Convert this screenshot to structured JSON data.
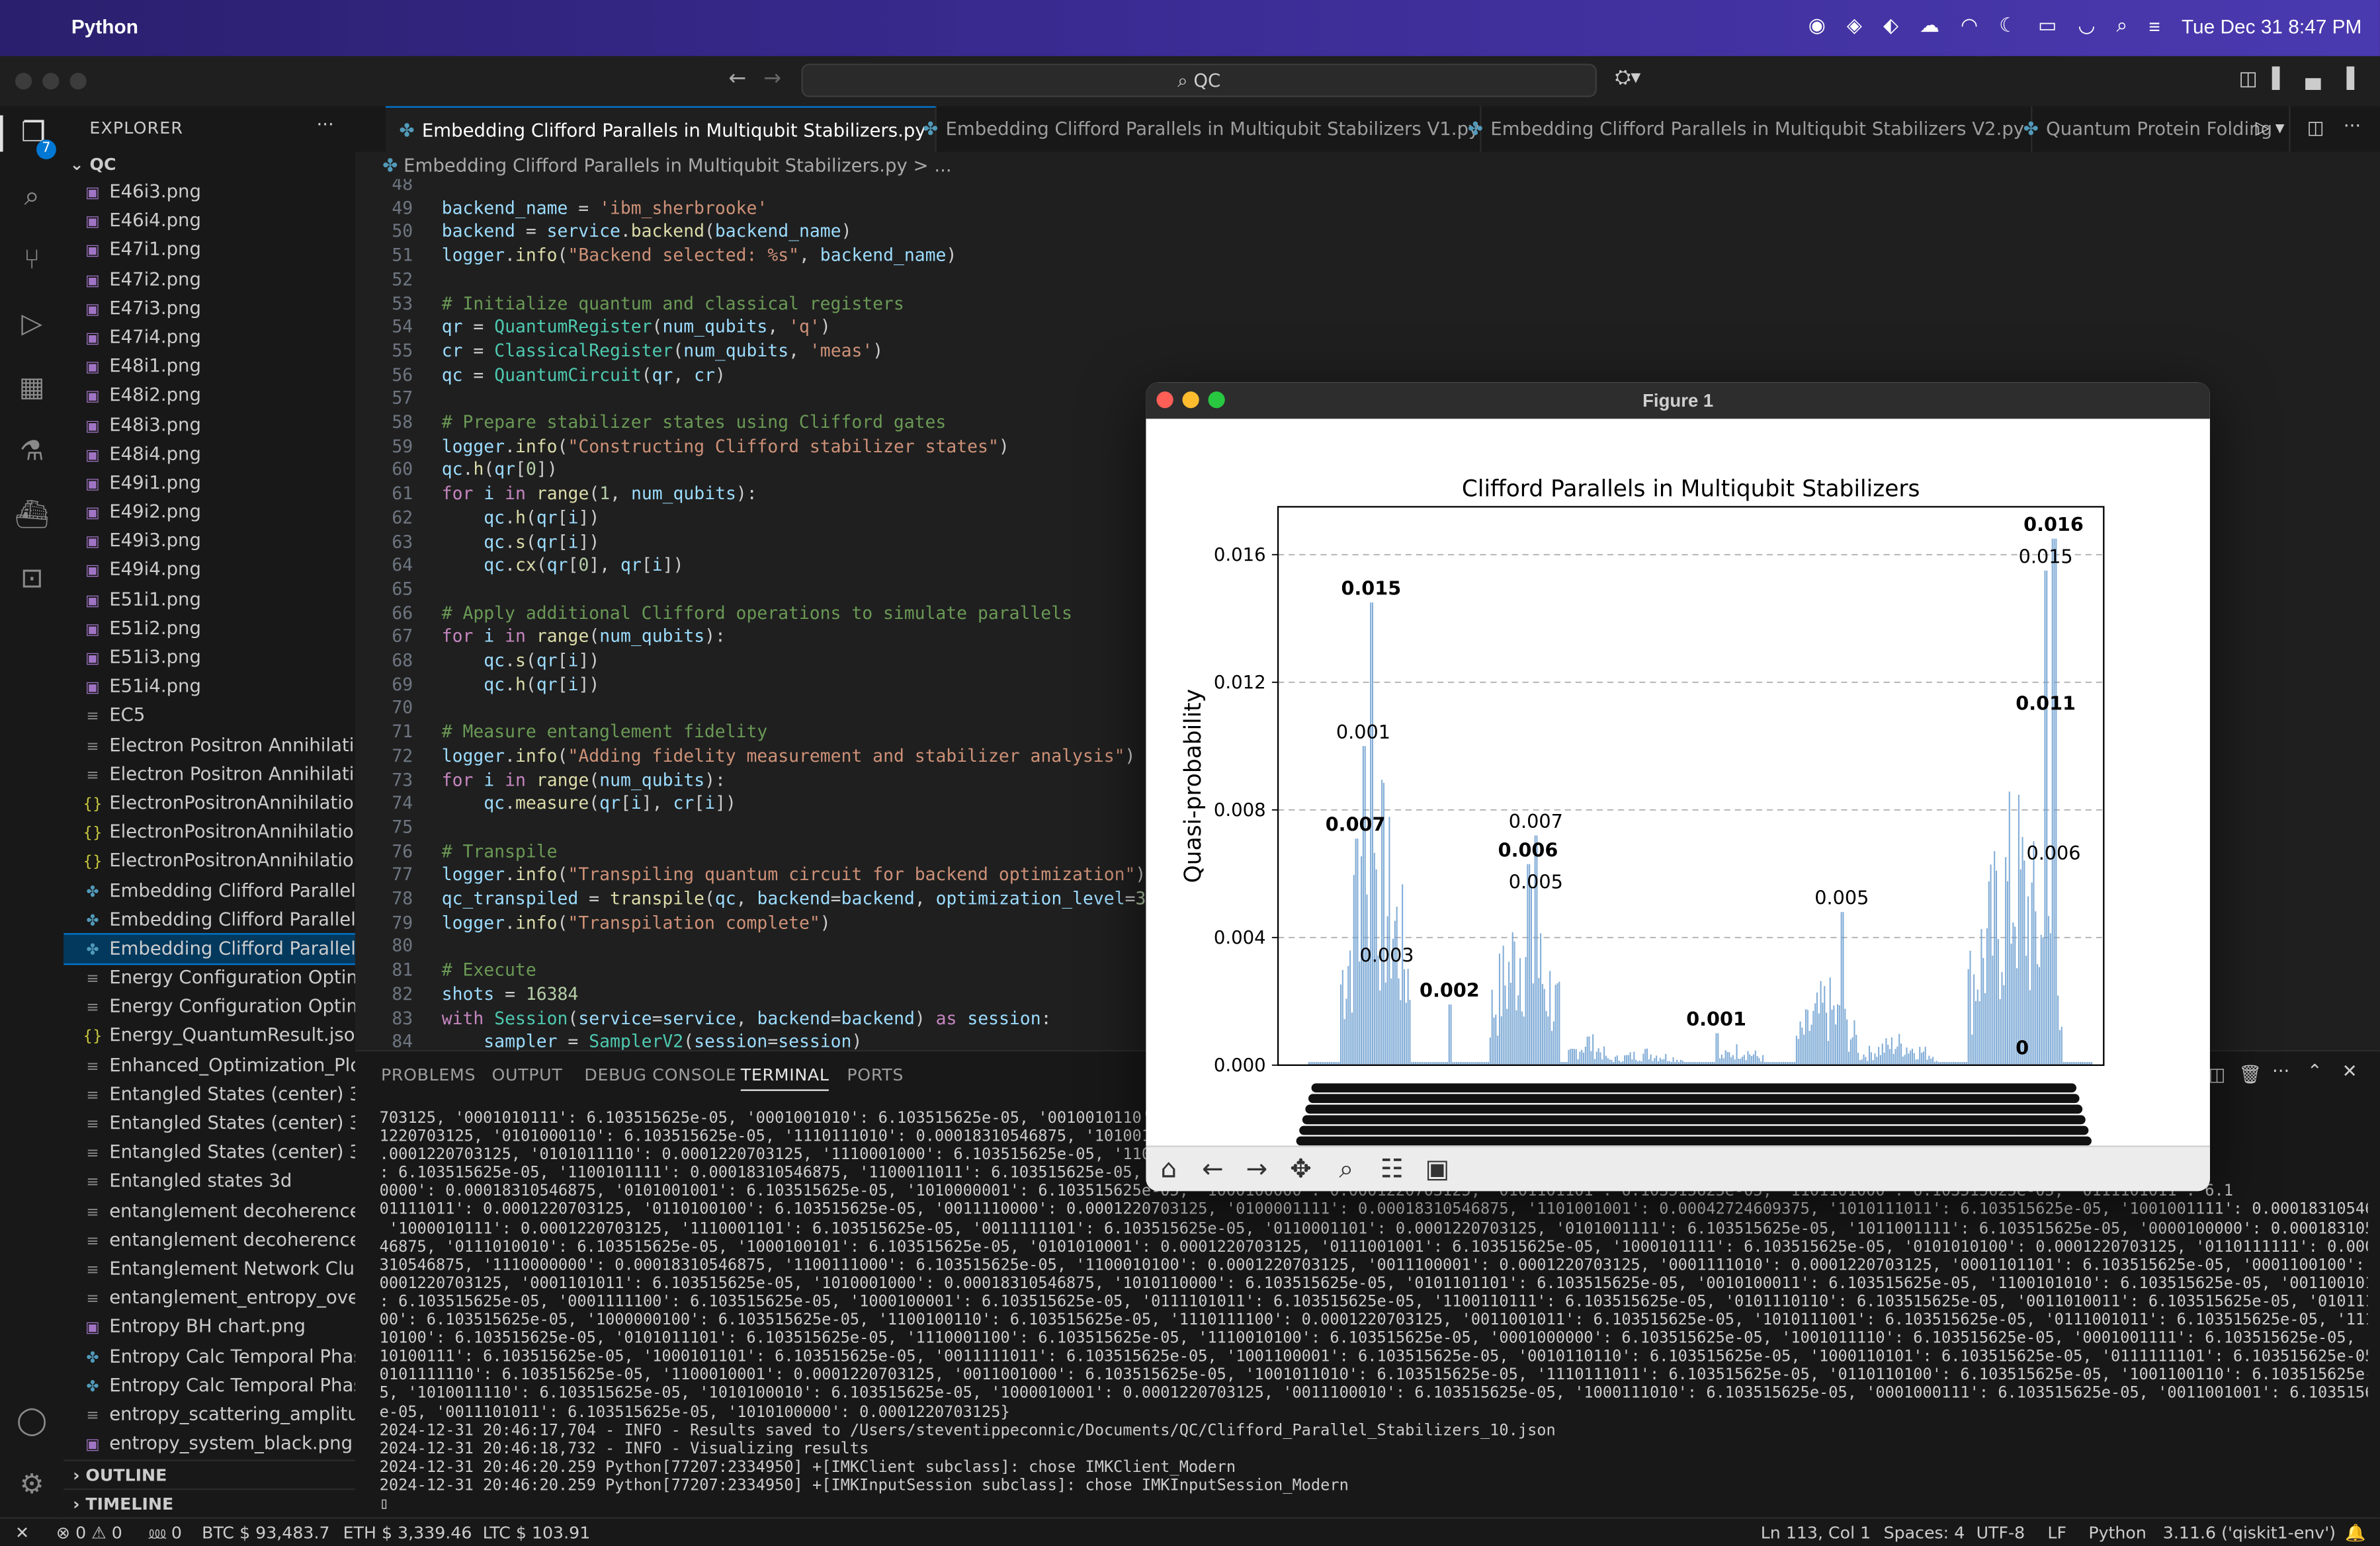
{
  "menubar": {
    "app_name": "Python",
    "datetime": "Tue Dec 31  8:47 PM",
    "icons": [
      "apple-icon",
      "control-icon",
      "record-icon",
      "vpn-icon",
      "cloud-icon",
      "airdrop-icon",
      "focus-moon-icon",
      "battery-icon",
      "wifi-icon",
      "spotlight-search-icon",
      "control-center-icon"
    ]
  },
  "titlebar": {
    "search": "QC"
  },
  "activity_bar": {
    "badge": "7"
  },
  "explorer": {
    "title": "EXPLORER",
    "more": "···",
    "root": "QC",
    "items": [
      {
        "name": "E46i3.png",
        "type": "png"
      },
      {
        "name": "E46i4.png",
        "type": "png"
      },
      {
        "name": "E47i1.png",
        "type": "png"
      },
      {
        "name": "E47i2.png",
        "type": "png"
      },
      {
        "name": "E47i3.png",
        "type": "png"
      },
      {
        "name": "E47i4.png",
        "type": "png"
      },
      {
        "name": "E48i1.png",
        "type": "png"
      },
      {
        "name": "E48i2.png",
        "type": "png"
      },
      {
        "name": "E48i3.png",
        "type": "png"
      },
      {
        "name": "E48i4.png",
        "type": "png"
      },
      {
        "name": "E49i1.png",
        "type": "png"
      },
      {
        "name": "E49i2.png",
        "type": "png"
      },
      {
        "name": "E49i3.png",
        "type": "png"
      },
      {
        "name": "E49i4.png",
        "type": "png"
      },
      {
        "name": "E51i1.png",
        "type": "png"
      },
      {
        "name": "E51i2.png",
        "type": "png"
      },
      {
        "name": "E51i3.png",
        "type": "png"
      },
      {
        "name": "E51i4.png",
        "type": "png"
      },
      {
        "name": "EC5",
        "type": "plain"
      },
      {
        "name": "Electron Positron Annihilatio...",
        "type": "plain"
      },
      {
        "name": "Electron Positron Annihilatio...",
        "type": "plain"
      },
      {
        "name": "ElectronPositronAnnihilation...",
        "type": "json"
      },
      {
        "name": "ElectronPositronAnnihilation...",
        "type": "json"
      },
      {
        "name": "ElectronPositronAnnihilation...",
        "type": "json"
      },
      {
        "name": "Embedding Clifford Parallels...",
        "type": "py"
      },
      {
        "name": "Embedding Clifford Parallels...",
        "type": "py"
      },
      {
        "name": "Embedding Clifford Parallels...",
        "type": "py",
        "selected": true
      },
      {
        "name": "Energy Configuration Optimi...",
        "type": "plain"
      },
      {
        "name": "Energy Configuration Optimi...",
        "type": "plain"
      },
      {
        "name": "Energy_QuantumResult.json",
        "type": "json"
      },
      {
        "name": "Enhanced_Optimization_Plo...",
        "type": "plain"
      },
      {
        "name": "Entangled States (center) 3d",
        "type": "plain"
      },
      {
        "name": "Entangled States (center) 3d...",
        "type": "plain"
      },
      {
        "name": "Entangled States (center) 3d...",
        "type": "plain"
      },
      {
        "name": "Entangled states 3d",
        "type": "plain"
      },
      {
        "name": "entanglement decoherence",
        "type": "plain"
      },
      {
        "name": "entanglement decoherence ...",
        "type": "plain"
      },
      {
        "name": "Entanglement Network Clust...",
        "type": "plain"
      },
      {
        "name": "entanglement_entropy_over...",
        "type": "plain"
      },
      {
        "name": "Entropy BH chart.png",
        "type": "png"
      },
      {
        "name": "Entropy Calc Temporal Phas...",
        "type": "py"
      },
      {
        "name": "Entropy Calc Temporal Phas...",
        "type": "py"
      },
      {
        "name": "entropy_scattering_amplitud...",
        "type": "plain"
      },
      {
        "name": "entropy_system_black.png",
        "type": "png"
      }
    ],
    "outline": "OUTLINE",
    "timeline": "TIMELINE"
  },
  "tabs": [
    {
      "label": "Embedding Clifford Parallels in Multiqubit Stabilizers.py",
      "active": true,
      "close": "×"
    },
    {
      "label": "Embedding Clifford Parallels in Multiqubit Stabilizers V1.py"
    },
    {
      "label": "Embedding Clifford Parallels in Multiqubit Stabilizers V2.py"
    },
    {
      "label": "Quantum Protein Folding"
    }
  ],
  "breadcrumb": "Embedding Clifford Parallels in Multiqubit Stabilizers.py > ...",
  "code_lines": [
    {
      "n": "48",
      "html": ""
    },
    {
      "n": "49",
      "html": "<span class='var'>backend_name</span> = <span class='str'>'ibm_sherbrooke'</span>"
    },
    {
      "n": "50",
      "html": "<span class='var'>backend</span> = <span class='var'>service</span>.<span class='fn'>backend</span>(<span class='var'>backend_name</span>)"
    },
    {
      "n": "51",
      "html": "<span class='var'>logger</span>.<span class='fn'>info</span>(<span class='str'>\"Backend selected: %s\"</span>, <span class='var'>backend_name</span>)"
    },
    {
      "n": "52",
      "html": ""
    },
    {
      "n": "53",
      "html": "<span class='cm'># Initialize quantum and classical registers</span>"
    },
    {
      "n": "54",
      "html": "<span class='var'>qr</span> = <span class='cls'>QuantumRegister</span>(<span class='var'>num_qubits</span>, <span class='str'>'q'</span>)"
    },
    {
      "n": "55",
      "html": "<span class='var'>cr</span> = <span class='cls'>ClassicalRegister</span>(<span class='var'>num_qubits</span>, <span class='str'>'meas'</span>)"
    },
    {
      "n": "56",
      "html": "<span class='var'>qc</span> = <span class='cls'>QuantumCircuit</span>(<span class='var'>qr</span>, <span class='var'>cr</span>)"
    },
    {
      "n": "57",
      "html": ""
    },
    {
      "n": "58",
      "html": "<span class='cm'># Prepare stabilizer states using Clifford gates</span>"
    },
    {
      "n": "59",
      "html": "<span class='var'>logger</span>.<span class='fn'>info</span>(<span class='str'>\"Constructing Clifford stabilizer states\"</span>)"
    },
    {
      "n": "60",
      "html": "<span class='var'>qc</span>.<span class='fn'>h</span>(<span class='var'>qr</span>[<span class='num'>0</span>])"
    },
    {
      "n": "61",
      "html": "<span class='kw'>for</span> <span class='var'>i</span> <span class='kw'>in</span> <span class='fn'>range</span>(<span class='num'>1</span>, <span class='var'>num_qubits</span>):"
    },
    {
      "n": "62",
      "html": "    <span class='var'>qc</span>.<span class='fn'>h</span>(<span class='var'>qr</span>[<span class='var'>i</span>])"
    },
    {
      "n": "63",
      "html": "    <span class='var'>qc</span>.<span class='fn'>s</span>(<span class='var'>qr</span>[<span class='var'>i</span>])"
    },
    {
      "n": "64",
      "html": "    <span class='var'>qc</span>.<span class='fn'>cx</span>(<span class='var'>qr</span>[<span class='num'>0</span>], <span class='var'>qr</span>[<span class='var'>i</span>])"
    },
    {
      "n": "65",
      "html": ""
    },
    {
      "n": "66",
      "html": "<span class='cm'># Apply additional Clifford operations to simulate parallels</span>"
    },
    {
      "n": "67",
      "html": "<span class='kw'>for</span> <span class='var'>i</span> <span class='kw'>in</span> <span class='fn'>range</span>(<span class='var'>num_qubits</span>):"
    },
    {
      "n": "68",
      "html": "    <span class='var'>qc</span>.<span class='fn'>s</span>(<span class='var'>qr</span>[<span class='var'>i</span>])"
    },
    {
      "n": "69",
      "html": "    <span class='var'>qc</span>.<span class='fn'>h</span>(<span class='var'>qr</span>[<span class='var'>i</span>])"
    },
    {
      "n": "70",
      "html": ""
    },
    {
      "n": "71",
      "html": "<span class='cm'># Measure entanglement fidelity</span>"
    },
    {
      "n": "72",
      "html": "<span class='var'>logger</span>.<span class='fn'>info</span>(<span class='str'>\"Adding fidelity measurement and stabilizer analysis\"</span>)"
    },
    {
      "n": "73",
      "html": "<span class='kw'>for</span> <span class='var'>i</span> <span class='kw'>in</span> <span class='fn'>range</span>(<span class='var'>num_qubits</span>):"
    },
    {
      "n": "74",
      "html": "    <span class='var'>qc</span>.<span class='fn'>measure</span>(<span class='var'>qr</span>[<span class='var'>i</span>], <span class='var'>cr</span>[<span class='var'>i</span>])"
    },
    {
      "n": "75",
      "html": ""
    },
    {
      "n": "76",
      "html": "<span class='cm'># Transpile</span>"
    },
    {
      "n": "77",
      "html": "<span class='var'>logger</span>.<span class='fn'>info</span>(<span class='str'>\"Transpiling quantum circuit for backend optimization\"</span>)"
    },
    {
      "n": "78",
      "html": "<span class='var'>qc_transpiled</span> = <span class='fn'>transpile</span>(<span class='var'>qc</span>, <span class='var'>backend</span>=<span class='var'>backend</span>, <span class='var'>optimization_level</span>=<span class='num'>3</span>)"
    },
    {
      "n": "79",
      "html": "<span class='var'>logger</span>.<span class='fn'>info</span>(<span class='str'>\"Transpilation complete\"</span>)"
    },
    {
      "n": "80",
      "html": ""
    },
    {
      "n": "81",
      "html": "<span class='cm'># Execute</span>"
    },
    {
      "n": "82",
      "html": "<span class='var'>shots</span> = <span class='num'>16384</span>"
    },
    {
      "n": "83",
      "html": "<span class='kw'>with</span> <span class='cls'>Session</span>(<span class='var'>service</span>=<span class='var'>service</span>, <span class='var'>backend</span>=<span class='var'>backend</span>) <span class='kw'>as</span> <span class='var'>session</span>:"
    },
    {
      "n": "84",
      "html": "    <span class='var'>sampler</span> = <span class='cls'>SamplerV2</span>(<span class='var'>session</span>=<span class='var'>session</span>)"
    }
  ],
  "panel": {
    "tabs": [
      "PROBLEMS",
      "OUTPUT",
      "DEBUG CONSOLE",
      "TERMINAL",
      "PORTS"
    ],
    "active_tab": "TERMINAL",
    "terminal_lines": [
      "703125, '0001010111': 6.103515625e-05, '0001001010': 6.103515625e-05, '0010010110'",
      "1220703125, '0101000110': 6.103515625e-05, '1110111010': 0.00018310546875, '101001",
      ".0001220703125, '0101011110': 0.0001220703125, '1110001000': 6.103515625e-05, '1100",
      ": 6.103515625e-05, '1100101111': 0.00018310546875, '1100011011': 6.103515625e-05,",
      "0000': 0.00018310546875, '0101001001': 6.103515625e-05, '1010000001': 6.103515625e-05, '1000100000': 0.0001220703125, '0101101101': 6.103515625e-05, '1101101000': 6.103515625e-05, '0111101011': 6.1",
      "01111011': 0.0001220703125, '0110100100': 6.103515625e-05, '0011110000': 0.0001220703125, '0100001111': 0.00018310546875, '1101001001': 0.00042724609375, '1010111011': 6.103515625e-05, '1001001111': 0.00018310546875",
      " '1000010111': 0.0001220703125, '1110001101': 6.103515625e-05, '0011111101': 6.103515625e-05, '0110001101': 0.0001220703125, '0101001111': 6.103515625e-05, '1011001111': 6.103515625e-05, '0000100000': 0.000183105",
      "46875, '0111010010': 6.103515625e-05, '1000100101': 6.103515625e-05, '0101010001': 0.0001220703125, '0111001001': 6.103515625e-05, '1000101111': 6.103515625e-05, '0101010100': 0.0001220703125, '0110111111': 0.00018",
      "310546875, '1110000000': 0.00018310546875, '1100111000': 6.103515625e-05, '1100010100': 0.0001220703125, '0011100001': 0.0001220703125, '0001111010': 0.0001220703125, '0001101101': 6.103515625e-05, '0001100100': 0.",
      "0001220703125, '0001101011': 6.103515625e-05, '1010001000': 0.00018310546875, '1010110000': 6.103515625e-05, '0101101101': 6.103515625e-05, '0010100011': 6.103515625e-05, '1100101010': 6.103515625e-05, '0011001011'",
      ": 6.103515625e-05, '0001111100': 6.103515625e-05, '1000100001': 6.103515625e-05, '0111101011': 6.103515625e-05, '1100110111': 6.103515625e-05, '0101110110': 6.103515625e-05, '0011010011': 6.103515625e-05, '010111111",
      "00': 6.103515625e-05, '1000000100': 6.103515625e-05, '1100100110': 6.103515625e-05, '1110111100': 0.0001220703125, '0011001011': 6.103515625e-05, '1010111001': 6.103515625e-05, '0111001011': 6.103515625e-05, '11100",
      "10100': 6.103515625e-05, '0101011101': 6.103515625e-05, '1110001100': 6.103515625e-05, '1110010100': 6.103515625e-05, '0001000000': 6.103515625e-05, '1001011110': 6.103515625e-05, '0001001111': 6.103515625e-05, '11",
      "10100111': 6.103515625e-05, '1000101101': 6.103515625e-05, '0011111011': 6.103515625e-05, '1001100001': 6.103515625e-05, '0010110110': 6.103515625e-05, '1000110101': 6.103515625e-05, '0111111101': 6.103515625e-05, '",
      "0101111110': 6.103515625e-05, '1100010001': 0.0001220703125, '0011001000': 6.103515625e-05, '1001011010': 6.103515625e-05, '1110111011': 6.103515625e-05, '0110110100': 6.103515625e-05, '1001100110': 6.103515625e-0",
      "5, '1010011110': 6.103515625e-05, '1010100010': 6.103515625e-05, '1000010001': 0.0001220703125, '0011100010': 6.103515625e-05, '1000111010': 6.103515625e-05, '0001000111': 6.103515625e-05, '0011001001': 6.103515625",
      "e-05, '0011101011': 6.103515625e-05, '1010100000': 0.0001220703125}",
      "2024-12-31 20:46:17,704 - INFO - Results saved to /Users/steventippeconnic/Documents/QC/Clifford_Parallel_Stabilizers_10.json",
      "2024-12-31 20:46:18,732 - INFO - Visualizing results",
      "2024-12-31 20:46:20.259 Python[77207:2334950] +[IMKClient subclass]: chose IMKClient_Modern",
      "2024-12-31 20:46:20.259 Python[77207:2334950] +[IMKInputSession subclass]: chose IMKInputSession_Modern",
      "▯"
    ]
  },
  "statusbar": {
    "errors": "⊗ 0 ⚠ 0",
    "ports": "⅏ 0",
    "btc": "BTC $ 93,483.7",
    "eth": "ETH $ 3,339.46",
    "ltc": "LTC $ 103.91",
    "position": "Ln 113, Col 1",
    "spaces": "Spaces: 4",
    "encoding": "UTF-8",
    "eol": "LF",
    "language": "Python",
    "interpreter": "3.11.6 ('qiskit1-env')"
  },
  "figure": {
    "window_title": "Figure 1",
    "toolbar_icons": [
      "home-icon",
      "back-arrow-icon",
      "forward-arrow-icon",
      "pan-move-icon",
      "zoom-magnifier-icon",
      "configure-subplots-icon",
      "save-disk-icon"
    ]
  },
  "chart_data": {
    "type": "bar",
    "title": "Clifford Parallels in Multiqubit Stabilizers",
    "ylabel": "Quasi-probability",
    "xlabel": "",
    "ylim": [
      0,
      0.0175
    ],
    "yticks": [
      0.0,
      0.004,
      0.008,
      0.012,
      0.016
    ],
    "ytick_labels": [
      "0.000",
      "0.004",
      "0.008",
      "0.012",
      "0.016"
    ],
    "grid": "y-dashed",
    "color": "#6c9fd0",
    "annotated_peaks": [
      {
        "label": "0.015",
        "value": 0.0145,
        "position": 0.08
      },
      {
        "label": "0.001",
        "value": 0.01,
        "position": 0.07
      },
      {
        "label": "0.007",
        "value": 0.0071,
        "position": 0.06
      },
      {
        "label": "0.003",
        "value": 0.003,
        "position": 0.1
      },
      {
        "label": "0.002",
        "value": 0.0019,
        "position": 0.18
      },
      {
        "label": "0.007",
        "value": 0.0072,
        "position": 0.29
      },
      {
        "label": "0.006",
        "value": 0.0063,
        "position": 0.28
      },
      {
        "label": "0.005",
        "value": 0.0053,
        "position": 0.29
      },
      {
        "label": "0.001",
        "value": 0.001,
        "position": 0.52
      },
      {
        "label": "0.005",
        "value": 0.0048,
        "position": 0.68
      },
      {
        "label": "0.016",
        "value": 0.0165,
        "position": 0.95
      },
      {
        "label": "0.015",
        "value": 0.0155,
        "position": 0.94
      },
      {
        "label": "0.011",
        "value": 0.0109,
        "position": 0.94
      },
      {
        "label": "0.006",
        "value": 0.0062,
        "position": 0.95
      },
      {
        "label": "0",
        "value": 0.0001,
        "position": 0.91
      }
    ]
  }
}
